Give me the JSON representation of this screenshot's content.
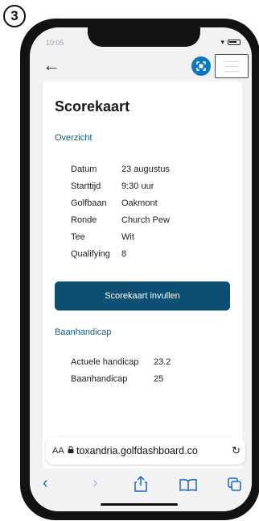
{
  "step_badge": "3",
  "status": {
    "time": "10:05"
  },
  "page": {
    "title": "Scorekaart"
  },
  "overview": {
    "heading": "Overzicht",
    "rows": [
      {
        "label": "Datum",
        "value": "23 augustus"
      },
      {
        "label": "Starttijd",
        "value": "9:30 uur"
      },
      {
        "label": "Golfbaan",
        "value": "Oakmont"
      },
      {
        "label": "Ronde",
        "value": "Church Pew"
      },
      {
        "label": "Tee",
        "value": "Wit"
      },
      {
        "label": "Qualifying",
        "value": "8"
      }
    ]
  },
  "cta": {
    "label": "Scorekaart invullen"
  },
  "handicap": {
    "heading": "Baanhandicap",
    "rows": [
      {
        "label": "Actuele handicap",
        "value": "23.2"
      },
      {
        "label": "Baanhandicap",
        "value": "25"
      }
    ]
  },
  "browser": {
    "aa_label": "AA",
    "url": "toxandria.golfdashboard.co",
    "icons": [
      "back-icon",
      "forward-icon",
      "share-icon",
      "bookmarks-icon",
      "tabs-icon",
      "reload-icon",
      "lock-icon"
    ]
  },
  "colors": {
    "accent": "#0c4f72",
    "link": "#1c64c8",
    "scan": "#0d76b8"
  }
}
